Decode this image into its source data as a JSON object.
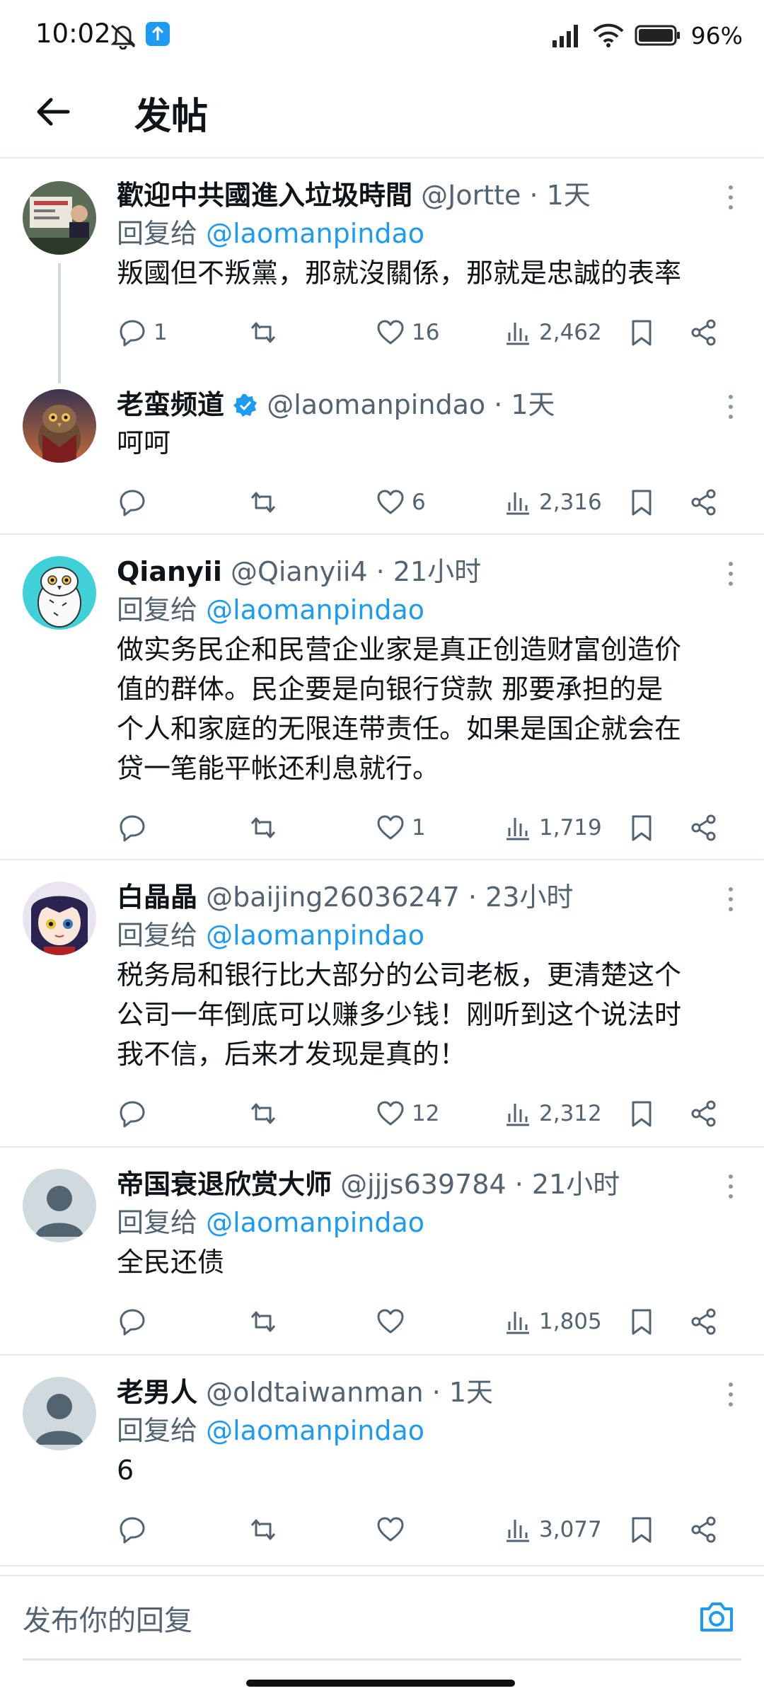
{
  "status_bar": {
    "time": "10:02",
    "battery": "96%",
    "icons": [
      "mute-alarm-icon",
      "upload-icon",
      "signal-icon",
      "wifi-icon",
      "battery-icon"
    ]
  },
  "header": {
    "title": "发帖",
    "back_icon": "arrow-left-icon"
  },
  "threads": [
    {
      "tweets": [
        {
          "name": "歡迎中共國進入垃圾時間",
          "handle": "@Jortte",
          "time": "· 1天",
          "reply_prefix": "回复给",
          "reply_to": "@laomanpindao",
          "text": [
            "叛國但不叛黨，那就沒關係，那就是忠誠的表率"
          ],
          "reply_count": "1",
          "retweet_count": "",
          "like_count": "16",
          "views": "2,462"
        },
        {
          "name": "老蛮频道",
          "verified": true,
          "handle": "@laomanpindao",
          "time": "· 1天",
          "text": [
            "呵呵"
          ],
          "reply_count": "",
          "retweet_count": "",
          "like_count": "6",
          "views": "2,316"
        }
      ]
    },
    {
      "tweets": [
        {
          "name": "Qianyii",
          "handle": "@Qianyii4",
          "time": "· 21小时",
          "reply_prefix": "回复给",
          "reply_to": "@laomanpindao",
          "text": [
            "做实务民企和民营企业家是真正创造财富创造价",
            "值的群体。民企要是向银行贷款 那要承担的是",
            "个人和家庭的无限连带责任。如果是国企就会在",
            "贷一笔能平帐还利息就行。"
          ],
          "reply_count": "",
          "retweet_count": "",
          "like_count": "1",
          "views": "1,719"
        }
      ]
    },
    {
      "tweets": [
        {
          "name": "白晶晶",
          "handle": "@baijing26036247",
          "time": "· 23小时",
          "reply_prefix": "回复给",
          "reply_to": "@laomanpindao",
          "text": [
            "税务局和银行比大部分的公司老板，更清楚这个",
            "公司一年倒底可以赚多少钱！刚听到这个说法时",
            "我不信，后来才发现是真的！"
          ],
          "reply_count": "",
          "retweet_count": "",
          "like_count": "12",
          "views": "2,312"
        }
      ]
    },
    {
      "tweets": [
        {
          "name": "帝国衰退欣赏大师",
          "handle": "@jjjs639784",
          "time": "· 21小时",
          "reply_prefix": "回复给",
          "reply_to": "@laomanpindao",
          "text": [
            "全民还债"
          ],
          "reply_count": "",
          "retweet_count": "",
          "like_count": "",
          "views": "1,805"
        }
      ]
    },
    {
      "tweets": [
        {
          "name": "老男人",
          "handle": "@oldtaiwanman",
          "time": "· 1天",
          "reply_prefix": "回复给",
          "reply_to": "@laomanpindao",
          "text": [
            "6"
          ],
          "reply_count": "",
          "retweet_count": "",
          "like_count": "",
          "views": "3,077"
        }
      ]
    }
  ],
  "composer": {
    "placeholder": "发布你的回复",
    "camera_icon": "camera-icon"
  },
  "colors": {
    "accent": "#1d9bf0",
    "text": "#0f1419",
    "secondary": "#536471",
    "divider": "#e6e9eb"
  }
}
